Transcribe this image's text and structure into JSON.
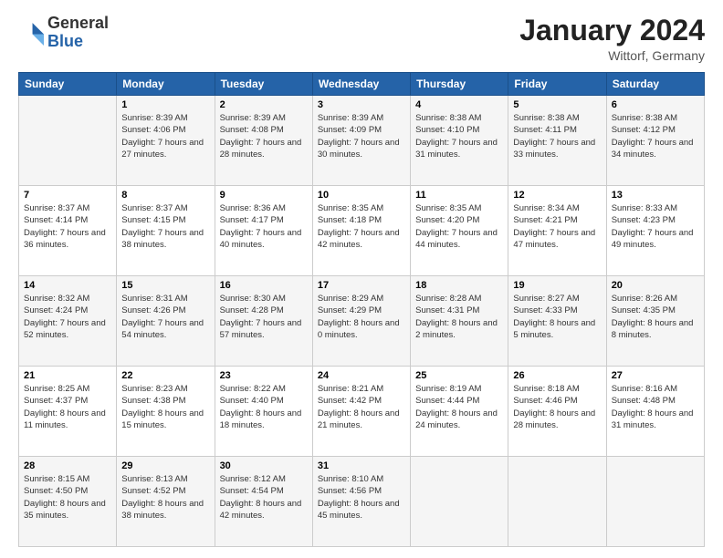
{
  "logo": {
    "general": "General",
    "blue": "Blue"
  },
  "header": {
    "month": "January 2024",
    "location": "Wittorf, Germany"
  },
  "days_of_week": [
    "Sunday",
    "Monday",
    "Tuesday",
    "Wednesday",
    "Thursday",
    "Friday",
    "Saturday"
  ],
  "weeks": [
    [
      {
        "day": "",
        "sunrise": "",
        "sunset": "",
        "daylight": ""
      },
      {
        "day": "1",
        "sunrise": "Sunrise: 8:39 AM",
        "sunset": "Sunset: 4:06 PM",
        "daylight": "Daylight: 7 hours and 27 minutes."
      },
      {
        "day": "2",
        "sunrise": "Sunrise: 8:39 AM",
        "sunset": "Sunset: 4:08 PM",
        "daylight": "Daylight: 7 hours and 28 minutes."
      },
      {
        "day": "3",
        "sunrise": "Sunrise: 8:39 AM",
        "sunset": "Sunset: 4:09 PM",
        "daylight": "Daylight: 7 hours and 30 minutes."
      },
      {
        "day": "4",
        "sunrise": "Sunrise: 8:38 AM",
        "sunset": "Sunset: 4:10 PM",
        "daylight": "Daylight: 7 hours and 31 minutes."
      },
      {
        "day": "5",
        "sunrise": "Sunrise: 8:38 AM",
        "sunset": "Sunset: 4:11 PM",
        "daylight": "Daylight: 7 hours and 33 minutes."
      },
      {
        "day": "6",
        "sunrise": "Sunrise: 8:38 AM",
        "sunset": "Sunset: 4:12 PM",
        "daylight": "Daylight: 7 hours and 34 minutes."
      }
    ],
    [
      {
        "day": "7",
        "sunrise": "Sunrise: 8:37 AM",
        "sunset": "Sunset: 4:14 PM",
        "daylight": "Daylight: 7 hours and 36 minutes."
      },
      {
        "day": "8",
        "sunrise": "Sunrise: 8:37 AM",
        "sunset": "Sunset: 4:15 PM",
        "daylight": "Daylight: 7 hours and 38 minutes."
      },
      {
        "day": "9",
        "sunrise": "Sunrise: 8:36 AM",
        "sunset": "Sunset: 4:17 PM",
        "daylight": "Daylight: 7 hours and 40 minutes."
      },
      {
        "day": "10",
        "sunrise": "Sunrise: 8:35 AM",
        "sunset": "Sunset: 4:18 PM",
        "daylight": "Daylight: 7 hours and 42 minutes."
      },
      {
        "day": "11",
        "sunrise": "Sunrise: 8:35 AM",
        "sunset": "Sunset: 4:20 PM",
        "daylight": "Daylight: 7 hours and 44 minutes."
      },
      {
        "day": "12",
        "sunrise": "Sunrise: 8:34 AM",
        "sunset": "Sunset: 4:21 PM",
        "daylight": "Daylight: 7 hours and 47 minutes."
      },
      {
        "day": "13",
        "sunrise": "Sunrise: 8:33 AM",
        "sunset": "Sunset: 4:23 PM",
        "daylight": "Daylight: 7 hours and 49 minutes."
      }
    ],
    [
      {
        "day": "14",
        "sunrise": "Sunrise: 8:32 AM",
        "sunset": "Sunset: 4:24 PM",
        "daylight": "Daylight: 7 hours and 52 minutes."
      },
      {
        "day": "15",
        "sunrise": "Sunrise: 8:31 AM",
        "sunset": "Sunset: 4:26 PM",
        "daylight": "Daylight: 7 hours and 54 minutes."
      },
      {
        "day": "16",
        "sunrise": "Sunrise: 8:30 AM",
        "sunset": "Sunset: 4:28 PM",
        "daylight": "Daylight: 7 hours and 57 minutes."
      },
      {
        "day": "17",
        "sunrise": "Sunrise: 8:29 AM",
        "sunset": "Sunset: 4:29 PM",
        "daylight": "Daylight: 8 hours and 0 minutes."
      },
      {
        "day": "18",
        "sunrise": "Sunrise: 8:28 AM",
        "sunset": "Sunset: 4:31 PM",
        "daylight": "Daylight: 8 hours and 2 minutes."
      },
      {
        "day": "19",
        "sunrise": "Sunrise: 8:27 AM",
        "sunset": "Sunset: 4:33 PM",
        "daylight": "Daylight: 8 hours and 5 minutes."
      },
      {
        "day": "20",
        "sunrise": "Sunrise: 8:26 AM",
        "sunset": "Sunset: 4:35 PM",
        "daylight": "Daylight: 8 hours and 8 minutes."
      }
    ],
    [
      {
        "day": "21",
        "sunrise": "Sunrise: 8:25 AM",
        "sunset": "Sunset: 4:37 PM",
        "daylight": "Daylight: 8 hours and 11 minutes."
      },
      {
        "day": "22",
        "sunrise": "Sunrise: 8:23 AM",
        "sunset": "Sunset: 4:38 PM",
        "daylight": "Daylight: 8 hours and 15 minutes."
      },
      {
        "day": "23",
        "sunrise": "Sunrise: 8:22 AM",
        "sunset": "Sunset: 4:40 PM",
        "daylight": "Daylight: 8 hours and 18 minutes."
      },
      {
        "day": "24",
        "sunrise": "Sunrise: 8:21 AM",
        "sunset": "Sunset: 4:42 PM",
        "daylight": "Daylight: 8 hours and 21 minutes."
      },
      {
        "day": "25",
        "sunrise": "Sunrise: 8:19 AM",
        "sunset": "Sunset: 4:44 PM",
        "daylight": "Daylight: 8 hours and 24 minutes."
      },
      {
        "day": "26",
        "sunrise": "Sunrise: 8:18 AM",
        "sunset": "Sunset: 4:46 PM",
        "daylight": "Daylight: 8 hours and 28 minutes."
      },
      {
        "day": "27",
        "sunrise": "Sunrise: 8:16 AM",
        "sunset": "Sunset: 4:48 PM",
        "daylight": "Daylight: 8 hours and 31 minutes."
      }
    ],
    [
      {
        "day": "28",
        "sunrise": "Sunrise: 8:15 AM",
        "sunset": "Sunset: 4:50 PM",
        "daylight": "Daylight: 8 hours and 35 minutes."
      },
      {
        "day": "29",
        "sunrise": "Sunrise: 8:13 AM",
        "sunset": "Sunset: 4:52 PM",
        "daylight": "Daylight: 8 hours and 38 minutes."
      },
      {
        "day": "30",
        "sunrise": "Sunrise: 8:12 AM",
        "sunset": "Sunset: 4:54 PM",
        "daylight": "Daylight: 8 hours and 42 minutes."
      },
      {
        "day": "31",
        "sunrise": "Sunrise: 8:10 AM",
        "sunset": "Sunset: 4:56 PM",
        "daylight": "Daylight: 8 hours and 45 minutes."
      },
      {
        "day": "",
        "sunrise": "",
        "sunset": "",
        "daylight": ""
      },
      {
        "day": "",
        "sunrise": "",
        "sunset": "",
        "daylight": ""
      },
      {
        "day": "",
        "sunrise": "",
        "sunset": "",
        "daylight": ""
      }
    ]
  ]
}
